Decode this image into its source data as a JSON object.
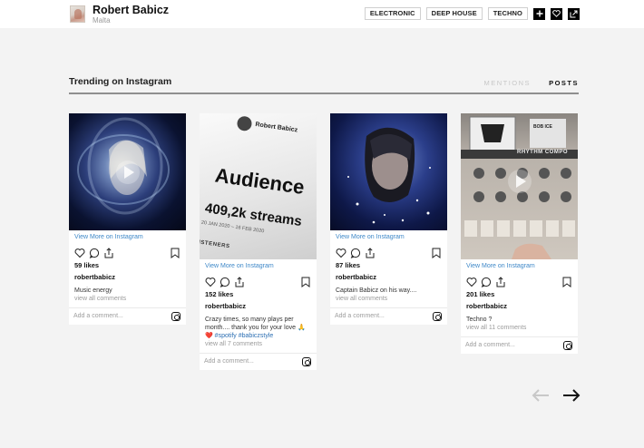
{
  "artist": {
    "name": "Robert Babicz",
    "location": "Malta"
  },
  "genre_tags": [
    "ELECTRONIC",
    "DEEP HOUSE",
    "TECHNO"
  ],
  "header_icons": [
    "plus-icon",
    "heart-icon",
    "share-icon"
  ],
  "section": {
    "title": "Trending on Instagram",
    "tab_mentions": "MENTIONS",
    "tab_posts": "POSTS"
  },
  "posts": [
    {
      "view_more": "View More on Instagram",
      "likes": "59 likes",
      "username": "robertbabicz",
      "caption": "Music energy",
      "comments": "view all comments",
      "add_comment": "Add a comment...",
      "is_video": true
    },
    {
      "view_more": "View More on Instagram",
      "likes": "152 likes",
      "username": "robertbabicz",
      "caption": "Crazy times, so many plays per month.... thank you for your love 🙏❤️",
      "hashtags": "#spotify #babiczstyle",
      "comments": "view all 7 comments",
      "add_comment": "Add a comment...",
      "image_text": {
        "name": "Robert Babicz",
        "headline": "Audience",
        "streams": "409,2k streams",
        "dates": "20 JAN 2020 – 16 FEB 2020",
        "footer": "LISTENERS"
      },
      "is_video": false
    },
    {
      "view_more": "View More on Instagram",
      "likes": "87 likes",
      "username": "robertbabicz",
      "caption": "Captain Babicz on his way....",
      "comments": "view all comments",
      "add_comment": "Add a comment...",
      "is_video": false
    },
    {
      "view_more": "View More on Instagram",
      "likes": "201 likes",
      "username": "robertbabicz",
      "caption": "Techno ?",
      "comments": "view all 11 comments",
      "add_comment": "Add a comment...",
      "image_text": {
        "header": "RHYTHM COMPO",
        "sticker": "BOB ICE"
      },
      "is_video": true
    }
  ],
  "pagination": {
    "prev_icon": "arrow-left-icon",
    "next_icon": "arrow-right-icon"
  }
}
